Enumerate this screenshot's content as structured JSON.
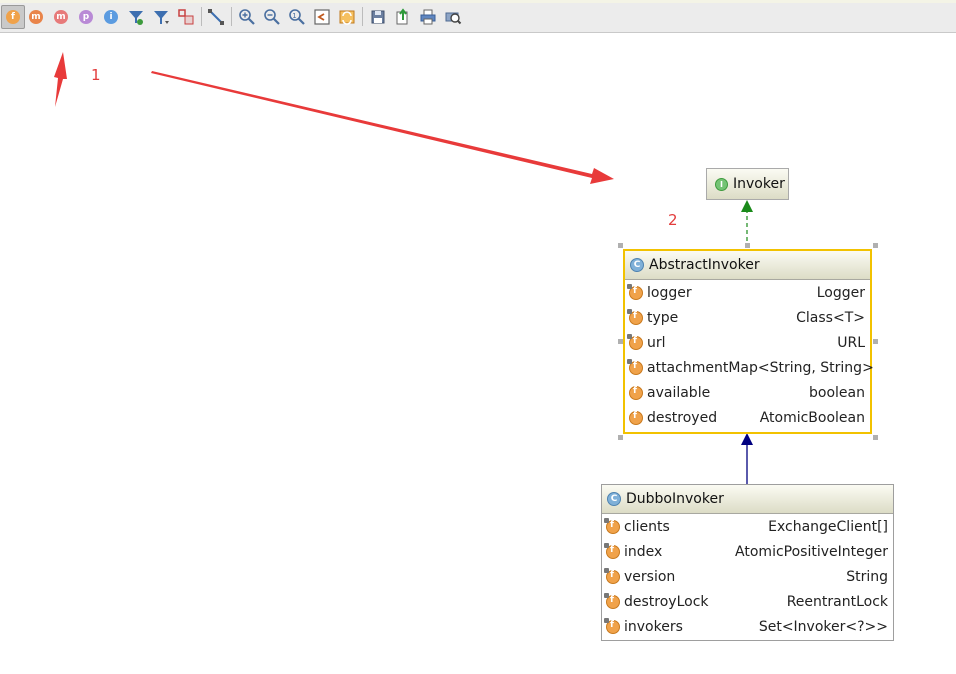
{
  "toolbar": {
    "buttons": [
      {
        "name": "fields-toggle-button",
        "glyph": "f",
        "color": "#f0a24a",
        "active": true
      },
      {
        "name": "constructors-toggle-button",
        "glyph": "m",
        "color": "#e9844a"
      },
      {
        "name": "methods-toggle-button",
        "glyph": "m",
        "color": "#e77a7a"
      },
      {
        "name": "properties-toggle-button",
        "glyph": "p",
        "color": "#b98ad6"
      },
      {
        "name": "inner-classes-toggle-button",
        "glyph": "i",
        "color": "#5b9be0"
      }
    ]
  },
  "annotations": {
    "label_1": "1",
    "label_2": "2"
  },
  "colors": {
    "arrow_red": "#e83a3a",
    "realization_green": "#1a8a1a",
    "inheritance_navy": "#000080",
    "selection_gold": "#f2c200"
  },
  "diagram": {
    "interface_stereo": "I",
    "class_stereo": "C",
    "invoker": {
      "name": "Invoker"
    },
    "abstract_invoker": {
      "name": "AbstractInvoker",
      "fields": [
        {
          "name": "logger",
          "type": "Logger"
        },
        {
          "name": "type",
          "type": "Class<T>"
        },
        {
          "name": "url",
          "type": "URL"
        },
        {
          "name": "attachment",
          "type": "Map<String, String>"
        },
        {
          "name": "available",
          "type": "boolean"
        },
        {
          "name": "destroyed",
          "type": "AtomicBoolean"
        }
      ]
    },
    "dubbo_invoker": {
      "name": "DubboInvoker",
      "fields": [
        {
          "name": "clients",
          "type": "ExchangeClient[]"
        },
        {
          "name": "index",
          "type": "AtomicPositiveInteger"
        },
        {
          "name": "version",
          "type": "String"
        },
        {
          "name": "destroyLock",
          "type": "ReentrantLock"
        },
        {
          "name": "invokers",
          "type": "Set<Invoker<?>>"
        }
      ]
    }
  }
}
